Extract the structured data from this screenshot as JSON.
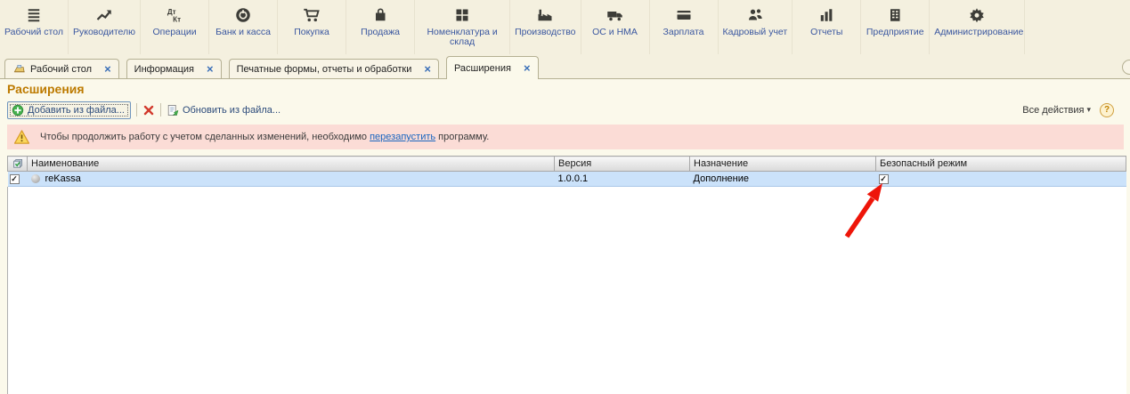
{
  "colors": {
    "title_accent": "#bd7a00",
    "link_blue": "#1a66c0",
    "warning_bg": "#fbdcd6",
    "selected_row_bg": "#cbe2fa",
    "arrow_red": "#ee1509",
    "ribbon_label_blue": "#3a57a0"
  },
  "icons": {
    "close_glyph": "×",
    "dropdown_glyph": "▾",
    "help_glyph": "?",
    "check_glyph": "✓"
  },
  "ribbon": {
    "items": [
      {
        "icon": "menu-icon",
        "label": "Рабочий стол"
      },
      {
        "icon": "trend-icon",
        "label": "Руководителю"
      },
      {
        "icon": "dtkt-icon",
        "label": "Операции"
      },
      {
        "icon": "coin-icon",
        "label": "Банк и касса"
      },
      {
        "icon": "cart-icon",
        "label": "Покупка"
      },
      {
        "icon": "bag-icon",
        "label": "Продажа"
      },
      {
        "icon": "grid-icon",
        "label": "Номенклатура и склад"
      },
      {
        "icon": "factory-icon",
        "label": "Производство"
      },
      {
        "icon": "truck-icon",
        "label": "ОС и НМА"
      },
      {
        "icon": "card-icon",
        "label": "Зарплата"
      },
      {
        "icon": "people-icon",
        "label": "Кадровый учет"
      },
      {
        "icon": "barchart-icon",
        "label": "Отчеты"
      },
      {
        "icon": "building-icon",
        "label": "Предприятие"
      },
      {
        "icon": "gear-icon",
        "label": "Администрирование"
      }
    ]
  },
  "tabs": {
    "items": [
      {
        "label": "Рабочий стол"
      },
      {
        "label": "Информация"
      },
      {
        "label": "Печатные формы, отчеты и обработки"
      },
      {
        "label": "Расширения"
      }
    ]
  },
  "page": {
    "title": "Расширения"
  },
  "toolbar": {
    "add_button": "Добавить из файла...",
    "update_button": "Обновить из файла...",
    "all_actions": "Все действия"
  },
  "warning": {
    "text_before": "Чтобы продолжить работу с учетом сделанных изменений, необходимо ",
    "link_text": "перезапустить",
    "text_after": " программу."
  },
  "table": {
    "columns": [
      "Наименование",
      "Версия",
      "Назначение",
      "Безопасный режим"
    ],
    "rows": [
      {
        "checked": true,
        "name": "reKassa",
        "version": "1.0.0.1",
        "purpose": "Дополнение",
        "safe_mode_checked": true
      }
    ]
  }
}
